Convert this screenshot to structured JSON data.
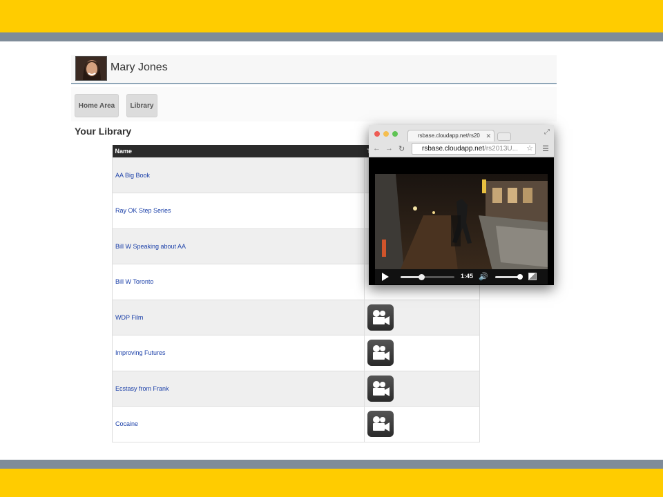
{
  "user": {
    "name": "Mary Jones"
  },
  "nav": {
    "home_label": "Home Area",
    "library_label": "Library"
  },
  "library": {
    "title": "Your Library",
    "columns": {
      "name": "Name",
      "type": "T"
    },
    "rows": [
      {
        "name": "AA Big Book"
      },
      {
        "name": "Ray OK Step Series"
      },
      {
        "name": "Bill W Speaking about AA"
      },
      {
        "name": "Bill W Toronto"
      },
      {
        "name": "WDP Film"
      },
      {
        "name": "Improving Futures"
      },
      {
        "name": "Ecstasy from Frank"
      },
      {
        "name": "Cocaine"
      }
    ]
  },
  "popup": {
    "tab_title": "rsbase.cloudapp.net/rs20",
    "url_host": "rsbase.cloudapp.net",
    "url_path": "/rs2013U...",
    "player": {
      "time": "1:45",
      "progress_fraction": 0.38,
      "volume_fraction": 0.9
    }
  },
  "colors": {
    "accent_yellow": "#ffcc00",
    "band_gray": "#7f8c99",
    "link_blue": "#1a3fa8"
  }
}
